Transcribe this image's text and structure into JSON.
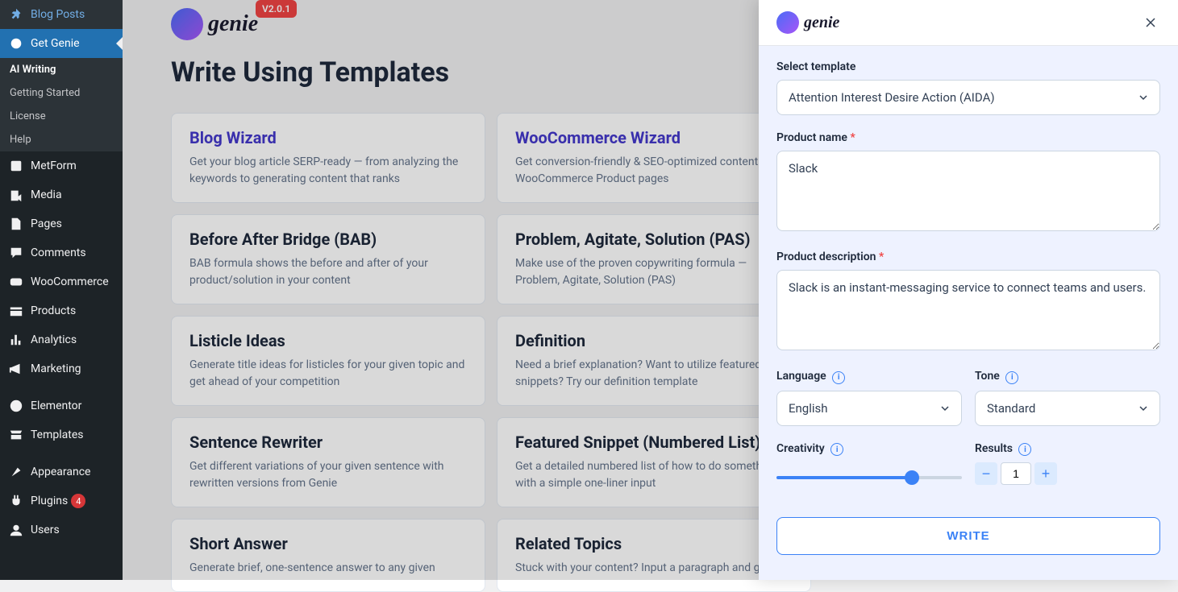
{
  "sidebar": {
    "items": [
      {
        "label": "Blog Posts",
        "icon": "pin"
      },
      {
        "label": "Get Genie",
        "icon": "genie",
        "active": true
      },
      {
        "label": "MetForm",
        "icon": "form"
      },
      {
        "label": "Media",
        "icon": "media"
      },
      {
        "label": "Pages",
        "icon": "pages"
      },
      {
        "label": "Comments",
        "icon": "comments"
      },
      {
        "label": "WooCommerce",
        "icon": "woo"
      },
      {
        "label": "Products",
        "icon": "products"
      },
      {
        "label": "Analytics",
        "icon": "analytics"
      },
      {
        "label": "Marketing",
        "icon": "marketing"
      },
      {
        "label": "Elementor",
        "icon": "elementor"
      },
      {
        "label": "Templates",
        "icon": "templates"
      },
      {
        "label": "Appearance",
        "icon": "appearance"
      },
      {
        "label": "Plugins",
        "icon": "plugins",
        "badge": "4"
      },
      {
        "label": "Users",
        "icon": "users"
      }
    ],
    "submenu": [
      {
        "label": "AI Writing",
        "active": true
      },
      {
        "label": "Getting Started"
      },
      {
        "label": "License"
      },
      {
        "label": "Help"
      }
    ]
  },
  "header": {
    "brand": "genie",
    "version": "V2.0.1"
  },
  "page_title": "Write Using Templates",
  "templates": [
    {
      "title": "Blog Wizard",
      "desc": "Get your blog article SERP-ready — from analyzing the keywords to generating content that ranks",
      "highlight": true
    },
    {
      "title": "WooCommerce Wizard",
      "desc": "Get conversion-friendly & SEO-optimized content for WooCommerce Product pages",
      "highlight": true
    },
    {
      "title": "Before After Bridge (BAB)",
      "desc": "BAB formula shows the before and after of your product/solution in your content"
    },
    {
      "title": "Problem, Agitate, Solution (PAS)",
      "desc": "Make use of the proven copywriting formula — Problem, Agitate, Solution (PAS)"
    },
    {
      "title": "Listicle Ideas",
      "desc": "Generate title ideas for listicles for your given topic and get ahead of your competition"
    },
    {
      "title": "Definition",
      "desc": "Need a brief explanation? Want to utilize featured snippets? Try our definition template"
    },
    {
      "title": "Sentence Rewriter",
      "desc": "Get different variations of your given sentence with rewritten versions from Genie"
    },
    {
      "title": "Featured Snippet (Numbered List)",
      "desc": "Get a detailed numbered list of how to do something with a simple one-liner input"
    },
    {
      "title": "Short Answer",
      "desc": "Generate brief, one-sentence answer to any given"
    },
    {
      "title": "Related Topics",
      "desc": "Stuck with your content? Input a paragraph and get"
    }
  ],
  "panel": {
    "brand": "genie",
    "select_template_label": "Select template",
    "select_template_value": "Attention Interest Desire Action (AIDA)",
    "product_name_label": "Product name",
    "product_name_value": "Slack",
    "product_desc_label": "Product description",
    "product_desc_value": "Slack is an instant-messaging service to connect teams and users.",
    "language_label": "Language",
    "language_value": "English",
    "tone_label": "Tone",
    "tone_value": "Standard",
    "creativity_label": "Creativity",
    "creativity_value": 75,
    "results_label": "Results",
    "results_value": "1",
    "write_label": "WRITE"
  }
}
